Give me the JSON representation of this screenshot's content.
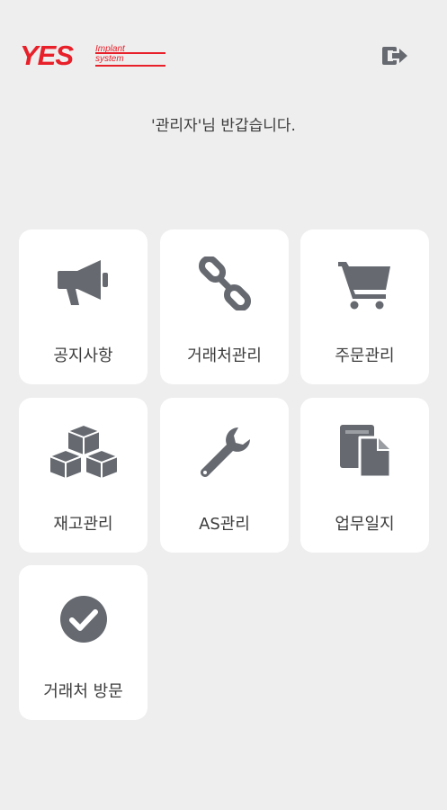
{
  "header": {
    "logo": {
      "brand": "YES",
      "line1": "Implant",
      "line2": "system"
    },
    "logout_icon": "logout-icon"
  },
  "welcome_text": "'관리자'님 반갑습니다.",
  "menu": [
    {
      "label": "공지사항",
      "icon": "megaphone-icon"
    },
    {
      "label": "거래처관리",
      "icon": "chain-link-icon"
    },
    {
      "label": "주문관리",
      "icon": "shopping-cart-icon"
    },
    {
      "label": "재고관리",
      "icon": "boxes-icon"
    },
    {
      "label": "AS관리",
      "icon": "wrench-icon"
    },
    {
      "label": "업무일지",
      "icon": "documents-icon"
    },
    {
      "label": "거래처 방문",
      "icon": "check-circle-icon"
    }
  ],
  "colors": {
    "background": "#eeeeee",
    "tile": "#ffffff",
    "icon": "#666a70",
    "brand": "#e8202a"
  }
}
